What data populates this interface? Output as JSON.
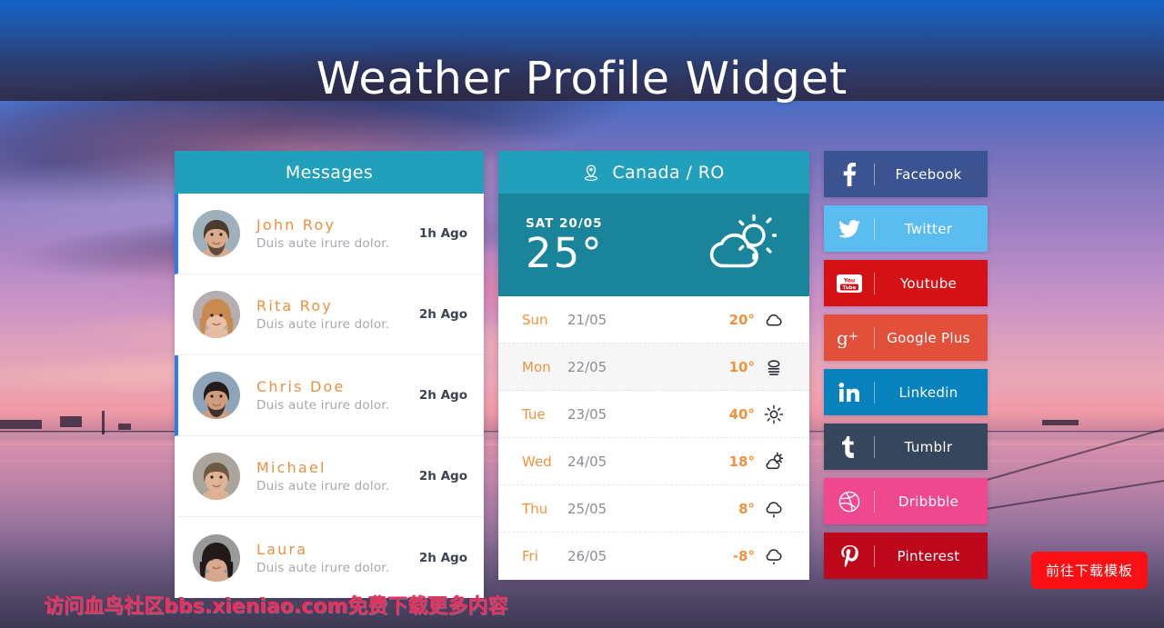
{
  "page": {
    "title": "Weather Profile Widget",
    "watermark": "访问血鸟社区bbs.xieniao.com免费下载更多内容",
    "download_button": "前往下载模板"
  },
  "colors": {
    "teal_header": "#219fbb",
    "teal_body": "#19849a",
    "accent_orange": "#ef9340",
    "active_bar": "#2a7fe0",
    "download_red": "#fa0f14",
    "watermark_pink": "#e8315e"
  },
  "messages": {
    "header": "Messages",
    "items": [
      {
        "name": "John Roy",
        "text": "Duis aute irure dolor.",
        "time": "1h Ago",
        "active": true,
        "avatar": "avatar-john"
      },
      {
        "name": "Rita Roy",
        "text": "Duis aute irure dolor.",
        "time": "2h Ago",
        "active": false,
        "avatar": "avatar-rita"
      },
      {
        "name": "Chris Doe",
        "text": "Duis aute irure dolor.",
        "time": "2h Ago",
        "active": true,
        "avatar": "avatar-chris"
      },
      {
        "name": "Michael",
        "text": "Duis aute irure dolor.",
        "time": "2h Ago",
        "active": false,
        "avatar": "avatar-michael"
      },
      {
        "name": "Laura",
        "text": "Duis aute irure dolor.",
        "time": "2h Ago",
        "active": false,
        "avatar": "avatar-laura"
      }
    ]
  },
  "weather": {
    "location": "Canada / RO",
    "location_icon": "map-pin-icon",
    "current": {
      "date": "SAT 20/05",
      "temp": "25°",
      "icon": "sun-behind-cloud-icon"
    },
    "forecast": [
      {
        "day": "Sun",
        "date": "21/05",
        "temp": "20°",
        "icon": "cloud-icon",
        "highlight": false
      },
      {
        "day": "Mon",
        "date": "22/05",
        "temp": "10°",
        "icon": "fog-icon",
        "highlight": true
      },
      {
        "day": "Tue",
        "date": "23/05",
        "temp": "40°",
        "icon": "sun-icon",
        "highlight": false
      },
      {
        "day": "Wed",
        "date": "24/05",
        "temp": "18°",
        "icon": "sun-behind-cloud-icon",
        "highlight": false
      },
      {
        "day": "Thu",
        "date": "25/05",
        "temp": "8°",
        "icon": "rain-icon",
        "highlight": false
      },
      {
        "day": "Fri",
        "date": "26/05",
        "temp": "-8°",
        "icon": "snow-icon",
        "highlight": false
      }
    ]
  },
  "social": [
    {
      "label": "Facebook",
      "icon": "facebook-icon",
      "color": "#3b5391"
    },
    {
      "label": "Twitter",
      "icon": "twitter-icon",
      "color": "#5bbcf0"
    },
    {
      "label": "Youtube",
      "icon": "youtube-icon",
      "color": "#d41215"
    },
    {
      "label": "Google Plus",
      "icon": "googleplus-icon",
      "color": "#e2503c"
    },
    {
      "label": "Linkedin",
      "icon": "linkedin-icon",
      "color": "#0782bd"
    },
    {
      "label": "Tumblr",
      "icon": "tumblr-icon",
      "color": "#36465d"
    },
    {
      "label": "Dribbble",
      "icon": "dribbble-icon",
      "color": "#f0488f"
    },
    {
      "label": "Pinterest",
      "icon": "pinterest-icon",
      "color": "#bd081c"
    }
  ]
}
